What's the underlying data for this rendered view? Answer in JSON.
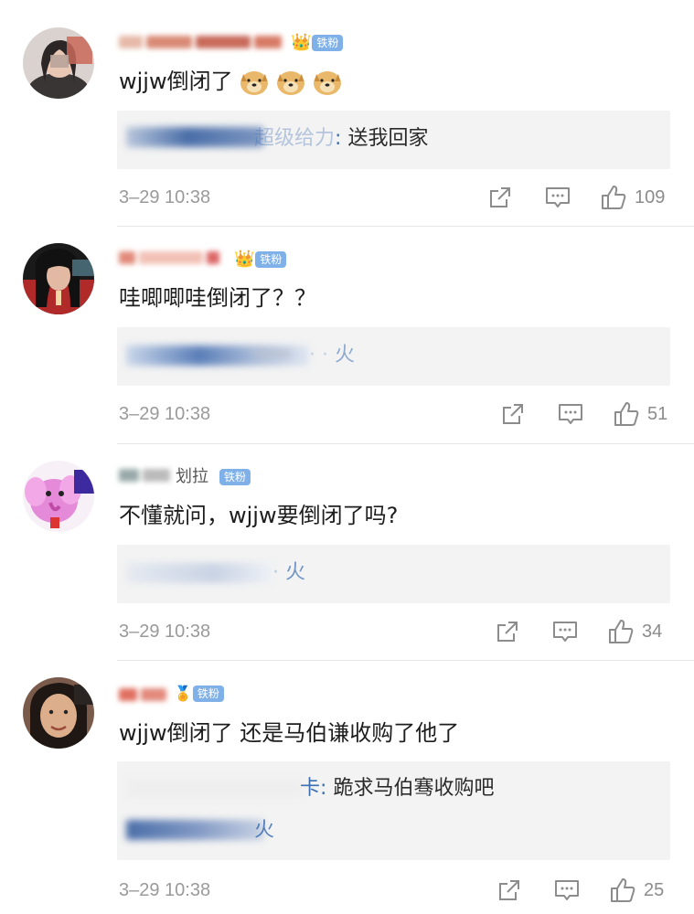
{
  "comments": [
    {
      "badge": "铁粉",
      "text": "wjjw倒闭了",
      "reply": {
        "name": "超级给力",
        "sep": ":",
        "content": "送我回家"
      },
      "time": "3–29 10:38",
      "likes": "109"
    },
    {
      "badge": "铁粉",
      "text": "哇唧唧哇倒闭了？？",
      "reply": {
        "tail": "火"
      },
      "time": "3–29 10:38",
      "likes": "51"
    },
    {
      "username_tail": "划拉",
      "badge": "铁粉",
      "text": "不懂就问，wjjw要倒闭了吗?",
      "reply": {
        "tail": "火"
      },
      "time": "3–29 10:38",
      "likes": "34"
    },
    {
      "badge": "铁粉",
      "text": "wjjw倒闭了 还是马伯谦收购了他了",
      "reply": {
        "name": "卡",
        "sep": ":",
        "content": "跪求马伯骞收购吧",
        "tail": "火"
      },
      "time": "3–29 10:38",
      "likes": "25"
    }
  ],
  "colors": {
    "fan_badge": "#7fb1e8",
    "reply_name": "#3d6fb3",
    "meta": "#9a9a9a"
  },
  "icons": [
    "share-icon",
    "comment-icon",
    "like-icon",
    "doge-emoji"
  ]
}
